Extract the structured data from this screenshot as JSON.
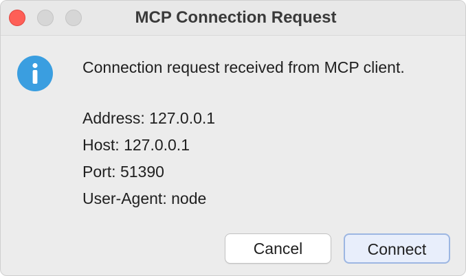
{
  "window": {
    "title": "MCP Connection Request"
  },
  "dialog": {
    "icon": "info-icon",
    "icon_color": "#3a9ee0",
    "message": "Connection request received from MCP client.",
    "details": [
      "Address: 127.0.0.1",
      "Host: 127.0.0.1",
      "Port: 51390",
      "User-Agent: node"
    ]
  },
  "buttons": {
    "cancel_label": "Cancel",
    "connect_label": "Connect"
  },
  "colors": {
    "close_button": "#fe5f57",
    "default_button_border": "#9cb6e2"
  }
}
